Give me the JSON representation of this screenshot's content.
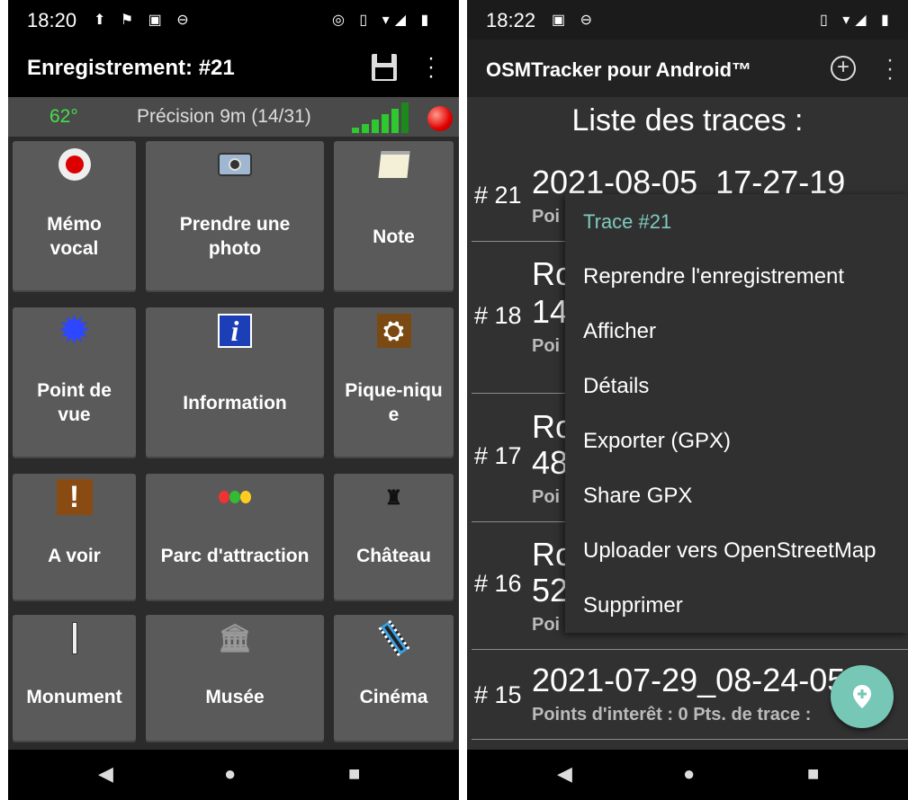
{
  "left": {
    "status_time": "18:20",
    "title": "Enregistrement: #21",
    "heading": "62°",
    "precision": "Précision 9m (14/31)",
    "buttons": [
      {
        "label": "Mémo\nvocal",
        "icon": "record-icon"
      },
      {
        "label": "Prendre une\nphoto",
        "icon": "camera-icon"
      },
      {
        "label": "Note",
        "icon": "note-icon"
      },
      {
        "label": "Point de\nvue",
        "icon": "viewpoint-icon"
      },
      {
        "label": "Information",
        "icon": "info-icon"
      },
      {
        "label": "Pique-niqu\ne",
        "icon": "picnic-icon"
      },
      {
        "label": "A voir",
        "icon": "exclamation-icon"
      },
      {
        "label": "Parc d'attraction",
        "icon": "balloons-icon"
      },
      {
        "label": "Château",
        "icon": "castle-icon"
      },
      {
        "label": "Monument",
        "icon": "monument-icon"
      },
      {
        "label": "Musée",
        "icon": "museum-icon"
      },
      {
        "label": "Cinéma",
        "icon": "film-icon"
      }
    ]
  },
  "right": {
    "status_time": "18:22",
    "app_title": "OSMTracker pour Android™",
    "list_title": "Liste des traces :",
    "traces": [
      {
        "num": "# 21",
        "name": "2021-08-05_17-27-19",
        "pts": "Poi"
      },
      {
        "num": "# 18",
        "name": "Ro",
        "name2": "14",
        "pts": "Poi"
      },
      {
        "num": "# 17",
        "name": "Ro",
        "name2": "48",
        "pts": "Poi"
      },
      {
        "num": "# 16",
        "name": "Ro",
        "name2": "52",
        "pts": "Poi"
      },
      {
        "num": "# 15",
        "name": "2021-07-29_08-24-05",
        "pts": "Points d'interêt : 0  Pts. de trace : "
      }
    ],
    "context_menu": {
      "header": "Trace #21",
      "items": [
        "Reprendre l'enregistrement",
        "Afficher",
        "Détails",
        "Exporter (GPX)",
        "Share GPX",
        "Uploader vers OpenStreetMap",
        "Supprimer"
      ]
    }
  },
  "colors": {
    "accent": "#76c7b6",
    "heading_green": "#44e04a",
    "menu_header": "#7fcbc0"
  }
}
